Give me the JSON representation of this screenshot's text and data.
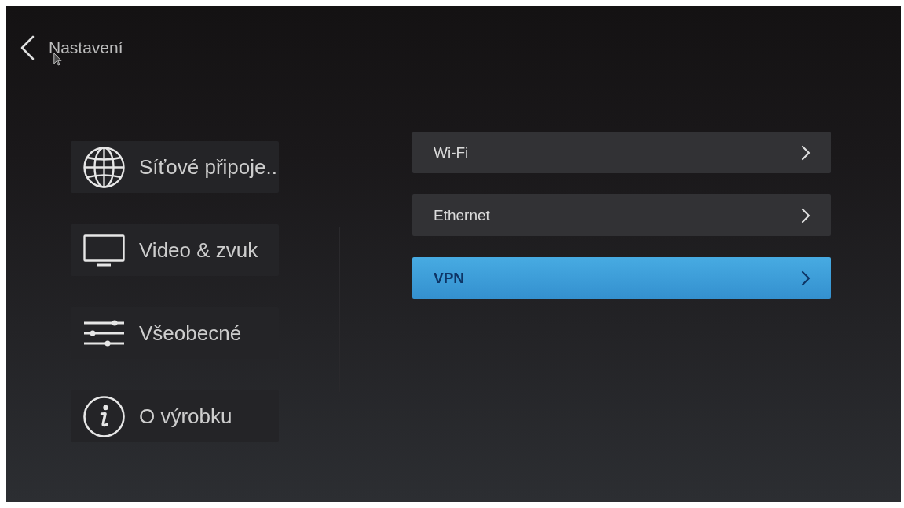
{
  "header": {
    "title": "Nastavení"
  },
  "categories": [
    {
      "kind": "globe",
      "label": "Síťové připoje.."
    },
    {
      "kind": "monitor",
      "label": "Video & zvuk"
    },
    {
      "kind": "sliders",
      "label": "Všeobecné"
    },
    {
      "kind": "info",
      "label": "O výrobku"
    }
  ],
  "network_options": [
    {
      "label": "Wi-Fi",
      "selected": false
    },
    {
      "label": "Ethernet",
      "selected": false
    },
    {
      "label": "VPN",
      "selected": true
    }
  ]
}
